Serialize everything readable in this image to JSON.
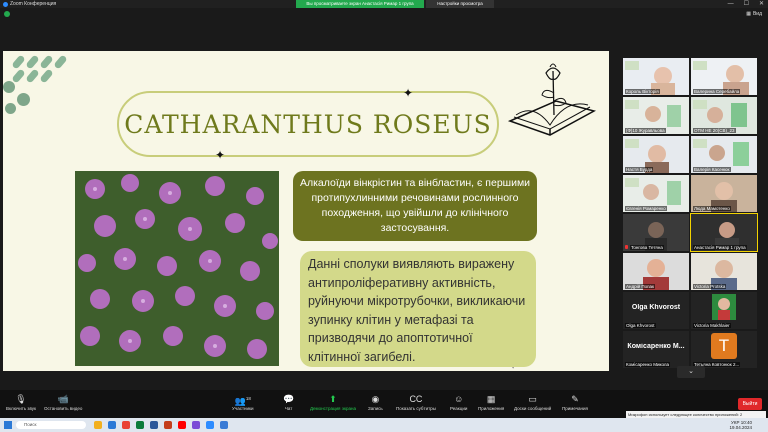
{
  "window": {
    "app_title": "Zoom Конференция",
    "share_banner": "Вы просматриваете экран Анастасія Римар 1 група",
    "view_options": "Настройки просмотра",
    "view_label": "Вид"
  },
  "slide": {
    "title": "CATHARANTHUS ROSEUS",
    "text1": "Алкалоїди вінкрістин та вінбластин, є першими протипухлинними речовинами рослинного походження, що увійшли до клінічного застосування.",
    "text2": "Данні сполуки виявляють виражену антипроліферативну активність, руйнуючи мікротрубочки, викликаючи зупинку клітин у метафазі та призводячи до апоптотичної клітинної загибелі."
  },
  "participants": [
    {
      "name": "Король Вікторія"
    },
    {
      "name": "Валерина Серебайла"
    },
    {
      "name": "(Ф)10 Журавльова"
    },
    {
      "name": "ОТМ НЕ 20(СВ)_23"
    },
    {
      "name": "Настя Бурда"
    },
    {
      "name": "Валерія Касенюк"
    },
    {
      "name": "Євгенія Ромаренко"
    },
    {
      "name": "Люда Мамотенко"
    },
    {
      "name": "Тонгова Тетяна"
    },
    {
      "name": "Анастасія Римар 1 група"
    },
    {
      "name": "Андрій Попак"
    },
    {
      "name": "Victoria Protska"
    },
    {
      "name": "Olga Khvorost",
      "big": "Olga Khvorost"
    },
    {
      "name": "Victoria Makhlaier"
    },
    {
      "name": "Комісаренко Микола",
      "big": "Комісаренко М..."
    },
    {
      "name": "Тетьяна Ковтонюк 2...",
      "avatar": "T"
    }
  ],
  "toolbar": {
    "mute": "Включить звук",
    "video": "Остановить видео",
    "participants": "Участники",
    "participants_count": "18",
    "chat": "Чат",
    "share": "Демонстрация экрана",
    "record": "Запись",
    "captions": "Показать субтитры",
    "reactions": "Реакции",
    "apps": "Приложения",
    "whiteboards": "Доски сообщений",
    "notes": "Примечания",
    "leave": "Выйти"
  },
  "taskbar": {
    "search": "Поиск",
    "lang": "УКР",
    "time": "10:40",
    "date": "19.04.2024",
    "notification": "Микрофон использует следующее количество приложений: 2"
  },
  "colors": {
    "slide_bg": "#f8f7e6",
    "title_color": "#6f7a1c",
    "box1_bg": "#6d7320",
    "box2_bg": "#d3d98a"
  }
}
